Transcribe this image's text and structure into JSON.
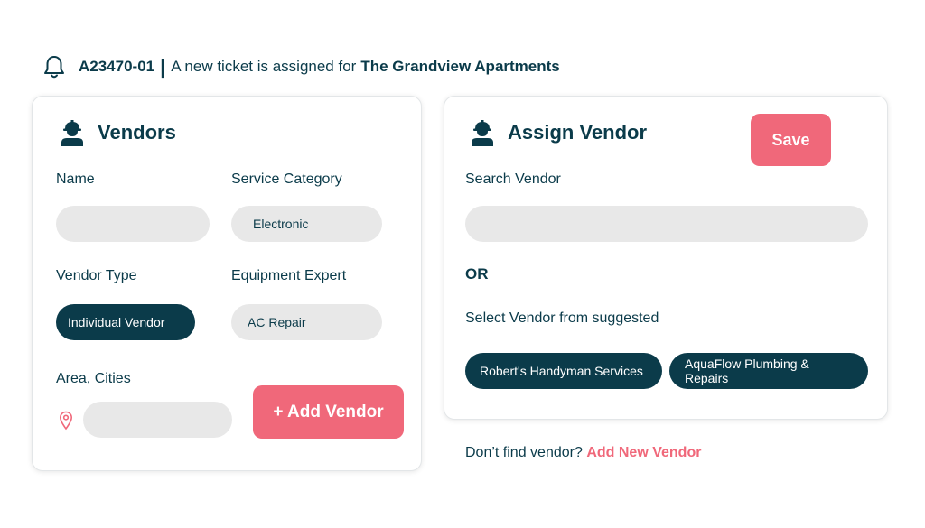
{
  "header": {
    "ticket_id": "A23470-01",
    "separator": "|",
    "message": "A new ticket is assigned for",
    "property": "The Grandview Apartments",
    "icon": "bell-icon"
  },
  "vendors_card": {
    "title": "Vendors",
    "icon": "worker-icon",
    "fields": {
      "name": {
        "label": "Name",
        "value": ""
      },
      "service_category": {
        "label": "Service Category",
        "value": "Electronic"
      },
      "vendor_type": {
        "label": "Vendor Type",
        "value": "Individual Vendor"
      },
      "equipment_expert": {
        "label": "Equipment Expert",
        "value": "AC Repair"
      },
      "area": {
        "label": "Area, Cities",
        "value": "",
        "icon": "location-pin-icon"
      }
    },
    "add_button": "+ Add Vendor"
  },
  "assign_card": {
    "title": "Assign Vendor",
    "icon": "worker-icon",
    "save_label": "Save",
    "search_label": "Search Vendor",
    "search_value": "",
    "or_text": "OR",
    "suggested_label": "Select Vendor from suggested",
    "suggested": [
      "Robert's Handyman Services",
      "AquaFlow Plumbing & Repairs"
    ]
  },
  "footer": {
    "text": "Don’t find vendor?",
    "link": "Add New Vendor"
  },
  "colors": {
    "primary": "#0b3b4a",
    "accent": "#f0687a",
    "field_bg": "#e8e8e8"
  }
}
